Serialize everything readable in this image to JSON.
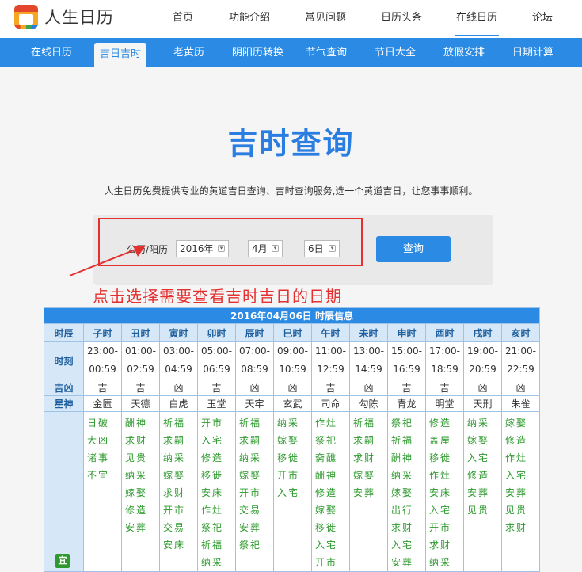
{
  "brand": {
    "name": "人生日历"
  },
  "top_nav": [
    {
      "label": "首页",
      "active": false
    },
    {
      "label": "功能介绍",
      "active": false
    },
    {
      "label": "常见问题",
      "active": false
    },
    {
      "label": "日历头条",
      "active": false
    },
    {
      "label": "在线日历",
      "active": true
    },
    {
      "label": "论坛",
      "active": false
    }
  ],
  "sub_nav": [
    {
      "label": "在线日历",
      "active": false
    },
    {
      "label": "吉日吉时",
      "active": true
    },
    {
      "label": "老黄历",
      "active": false
    },
    {
      "label": "阴阳历转换",
      "active": false
    },
    {
      "label": "节气查询",
      "active": false
    },
    {
      "label": "节日大全",
      "active": false
    },
    {
      "label": "放假安排",
      "active": false
    },
    {
      "label": "日期计算",
      "active": false
    }
  ],
  "page": {
    "title": "吉时查询",
    "description": "人生日历免费提供专业的黄道吉日查询、吉时查询服务,选一个黄道吉日，让您事事顺利。"
  },
  "form": {
    "label": "公历/阳历",
    "year": "2016年",
    "month": "4月",
    "day": "6日",
    "query_button": "查询"
  },
  "annotation": {
    "text": "点击选择需要查看吉时吉日的日期"
  },
  "table": {
    "caption": "2016年04月06日 时辰信息",
    "row_labels": {
      "shichen": "时辰",
      "shike": "时刻",
      "jixiong": "吉凶",
      "xingshen": "星神",
      "yi": "宜"
    },
    "columns": [
      {
        "name": "子时",
        "start": "23:00-",
        "end": "00:59",
        "jixiong": "吉",
        "xingshen": "金匮",
        "yi": "日破大凶诸事不宜"
      },
      {
        "name": "丑时",
        "start": "01:00-",
        "end": "02:59",
        "jixiong": "吉",
        "xingshen": "天德",
        "yi": "酬神求财见贵纳采嫁娶修造安葬"
      },
      {
        "name": "寅时",
        "start": "03:00-",
        "end": "04:59",
        "jixiong": "凶",
        "xingshen": "白虎",
        "yi": "祈福求嗣纳采嫁娶求财开市交易安床"
      },
      {
        "name": "卯时",
        "start": "05:00-",
        "end": "06:59",
        "jixiong": "吉",
        "xingshen": "玉堂",
        "yi": "开市入宅修造移徙安床作灶祭祀祈福纳采"
      },
      {
        "name": "辰时",
        "start": "07:00-",
        "end": "08:59",
        "jixiong": "凶",
        "xingshen": "天牢",
        "yi": "祈福求嗣纳采嫁娶开市交易安葬祭祀"
      },
      {
        "name": "巳时",
        "start": "09:00-",
        "end": "10:59",
        "jixiong": "凶",
        "xingshen": "玄武",
        "yi": "纳采嫁娶移徙开市入宅"
      },
      {
        "name": "午时",
        "start": "11:00-",
        "end": "12:59",
        "jixiong": "吉",
        "xingshen": "司命",
        "yi": "作灶祭祀斋醮酬神修造嫁娶移徙入宅开市"
      },
      {
        "name": "未时",
        "start": "13:00-",
        "end": "14:59",
        "jixiong": "凶",
        "xingshen": "勾陈",
        "yi": "祈福求嗣求财嫁娶安葬"
      },
      {
        "name": "申时",
        "start": "15:00-",
        "end": "16:59",
        "jixiong": "吉",
        "xingshen": "青龙",
        "yi": "祭祀祈福酬神纳采嫁娶出行求财入宅安葬"
      },
      {
        "name": "酉时",
        "start": "17:00-",
        "end": "18:59",
        "jixiong": "吉",
        "xingshen": "明堂",
        "yi": "修造盖屋移徙作灶安床入宅开市求财纳采"
      },
      {
        "name": "戌时",
        "start": "19:00-",
        "end": "20:59",
        "jixiong": "凶",
        "xingshen": "天刑",
        "yi": "纳采嫁娶入宅修造安葬见贵"
      },
      {
        "name": "亥时",
        "start": "21:00-",
        "end": "22:59",
        "jixiong": "凶",
        "xingshen": "朱雀",
        "yi": "嫁娶修造作灶入宅安葬见贵求财"
      }
    ]
  },
  "colors": {
    "accent": "#2a8ae4",
    "title": "#2a7de1",
    "annotation_red": "#e53030",
    "yi_green": "#2e9a2e"
  }
}
